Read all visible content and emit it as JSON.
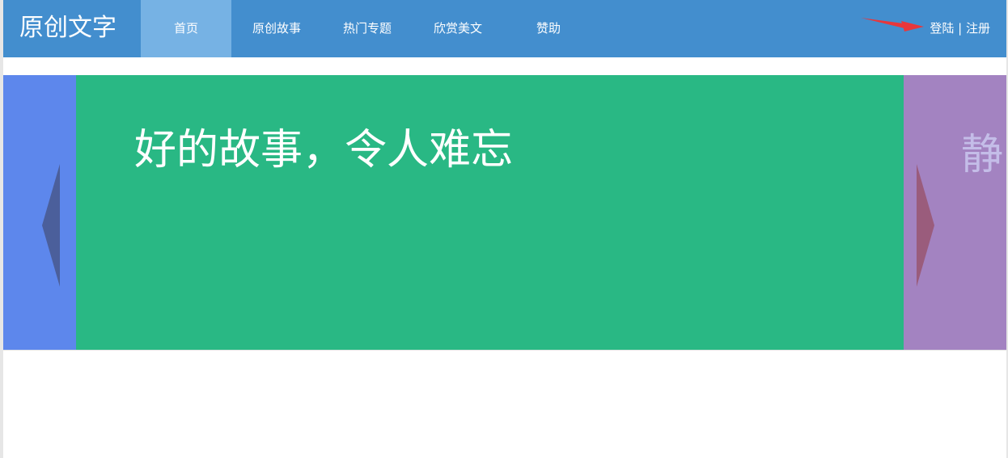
{
  "brand": {
    "name": "原创文字"
  },
  "nav": {
    "items": [
      {
        "label": "首页",
        "active": true
      },
      {
        "label": "原创故事",
        "active": false
      },
      {
        "label": "热门专题",
        "active": false
      },
      {
        "label": "欣赏美文",
        "active": false
      },
      {
        "label": "赞助",
        "active": false
      }
    ]
  },
  "auth": {
    "login": "登陆",
    "separator": "|",
    "register": "注册"
  },
  "carousel": {
    "current_title": "好的故事，令人难忘",
    "next_title_partial": "静",
    "prev_icon": "chevron-left-icon",
    "next_icon": "chevron-right-icon"
  },
  "colors": {
    "navbar": "#438ece",
    "nav_active": "#76b2e4",
    "slide_prev": "#5d87ec",
    "slide_current": "#29b884",
    "slide_next": "#a383c1",
    "annotation_arrow": "#e8373b"
  }
}
